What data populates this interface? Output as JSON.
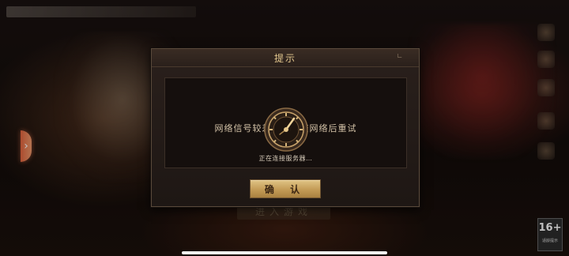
{
  "dialog": {
    "title": "提示",
    "message": "网络信号较差，请检查网络后重试",
    "status": "正在连接服务器…",
    "confirm_label": "确 认"
  },
  "background": {
    "enter_game_label": "进入游戏",
    "age_rating": "16+",
    "age_rating_caption": "适龄提示"
  },
  "colors": {
    "accent_gold": "#e0c486",
    "title_gold": "#e4c88f",
    "side_arrow_orange": "#e7663f"
  }
}
